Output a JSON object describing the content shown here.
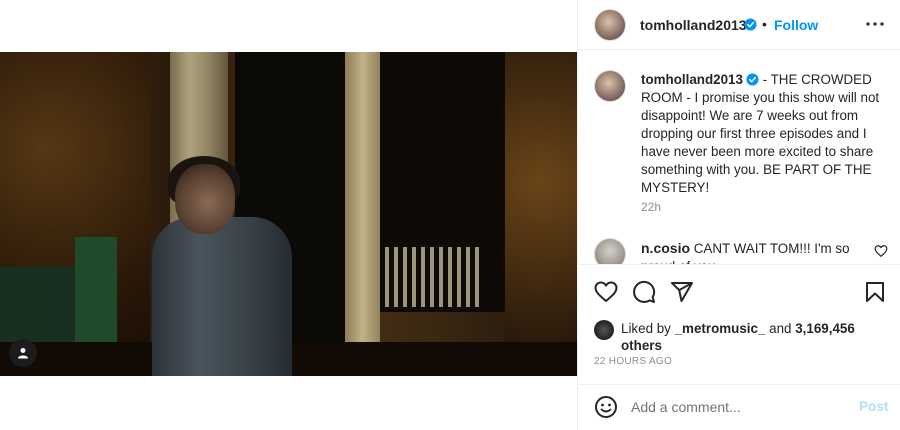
{
  "post": {
    "author": "tomholland2013",
    "follow_label": "Follow",
    "separator": "•",
    "caption": " - THE CROWDED ROOM - I promise you this show will not disappoint! We are 7 weeks out from dropping our first three episodes and I have never been more excited to share something with you. BE PART OF THE MYSTERY!",
    "caption_age": "22h",
    "verified_color": "#0095f6"
  },
  "comments": [
    {
      "username": "n.cosio",
      "text": " CANT WAIT TOM!!! I'm so proud of you"
    }
  ],
  "likes": {
    "prefix": "Liked by ",
    "liker": "_metromusic_",
    "joiner": " and ",
    "count": "3,169,456",
    "suffix": "others"
  },
  "timestamp": "22 HOURS AGO",
  "add_comment": {
    "placeholder": "Add a comment...",
    "post_label": "Post"
  },
  "icons": {
    "more": "more-options-icon",
    "heart": "heart-icon",
    "comment": "comment-icon",
    "share": "share-icon",
    "save": "bookmark-icon",
    "emoji": "emoji-icon",
    "user_tag": "user-tag-icon",
    "verified": "verified-badge-icon"
  },
  "colors": {
    "accent": "#0095f6",
    "post_disabled": "#b2dffc",
    "muted": "#8e8e8e"
  }
}
